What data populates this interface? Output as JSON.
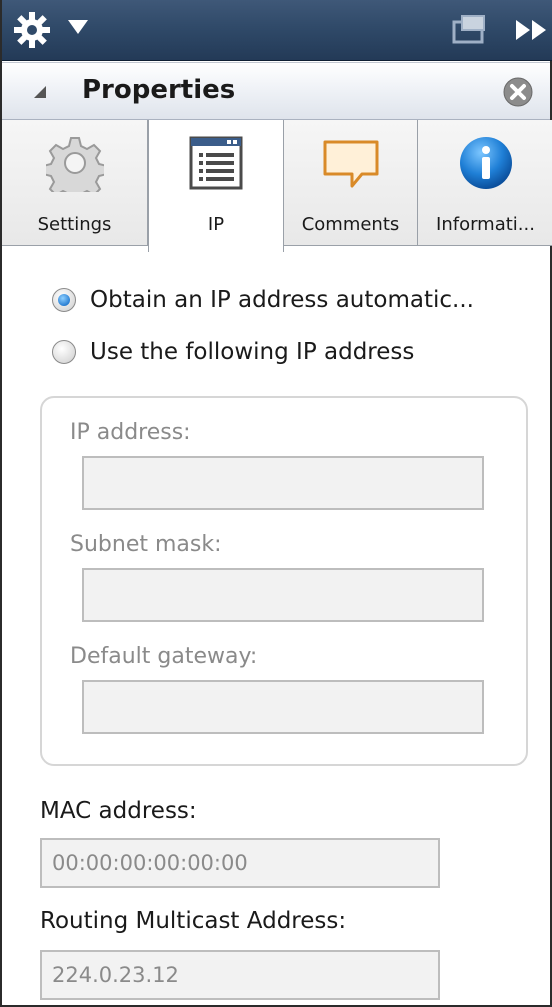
{
  "window": {
    "icons": {
      "menu": "gear-icon",
      "dropdown": "dropdown-arrow-icon",
      "dock": "dock-window-icon",
      "expand": "double-arrow-right-icon"
    }
  },
  "panel": {
    "title": "Properties",
    "close_icon": "close-circle-icon",
    "collapse_icon": "collapse-triangle-icon"
  },
  "tabs": [
    {
      "label": "Settings",
      "icon": "gear-icon",
      "active": false
    },
    {
      "label": "IP",
      "icon": "list-document-icon",
      "active": true
    },
    {
      "label": "Comments",
      "icon": "speech-bubble-icon",
      "active": false
    },
    {
      "label": "Informati...",
      "icon": "info-icon",
      "active": false
    }
  ],
  "ip_settings": {
    "auto_option": "Obtain an IP address automatic...",
    "auto_selected": true,
    "manual_option": "Use the following IP address",
    "manual_selected": false,
    "ip_address_label": "IP address:",
    "ip_address_value": "",
    "subnet_label": "Subnet mask:",
    "subnet_value": "",
    "gateway_label": "Default gateway:",
    "gateway_value": ""
  },
  "mac": {
    "label": "MAC address:",
    "value": "00:00:00:00:00:00"
  },
  "multicast": {
    "label": "Routing Multicast Address:",
    "value": "224.0.23.12"
  },
  "colors": {
    "titlebar": "#304a69",
    "radio_selected": "#2a7fd3",
    "disabled_text": "#8a8a8a"
  }
}
